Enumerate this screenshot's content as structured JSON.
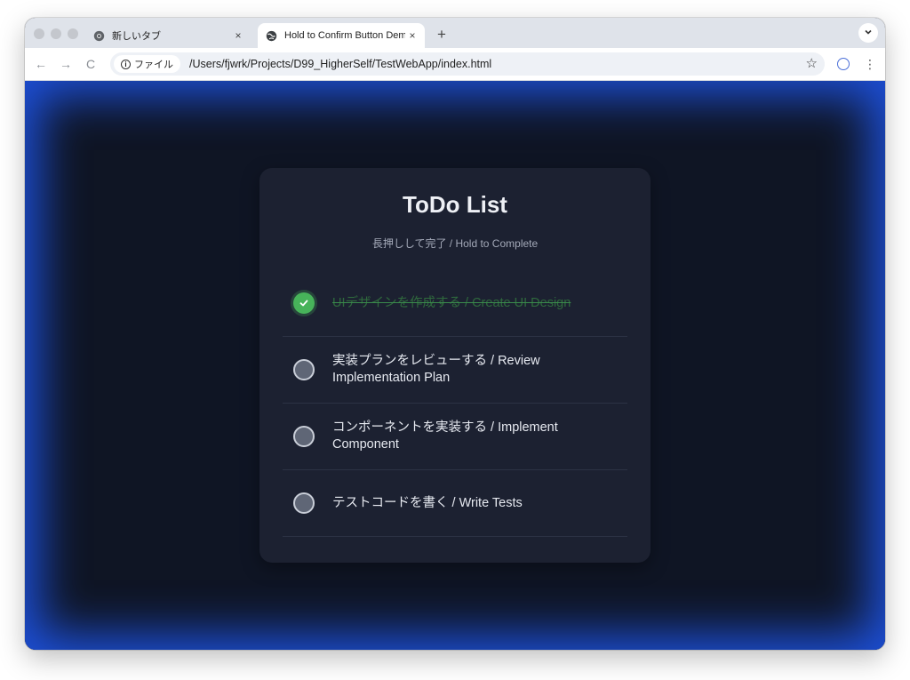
{
  "browser": {
    "tabs": [
      {
        "label": "新しいタブ",
        "close": "×",
        "active": false,
        "icon": "chrome-icon"
      },
      {
        "label": "Hold to Confirm Button Demo",
        "close": "×",
        "active": true,
        "icon": "globe-icon"
      }
    ],
    "new_tab": "+",
    "tab_search_icon": "chevron-down-icon",
    "nav": {
      "back": "←",
      "forward": "→",
      "reload": "C"
    },
    "address": {
      "scheme_chip": "ファイル",
      "url": "/Users/fjwrk/Projects/D99_HigherSelf/TestWebApp/index.html",
      "bookmark": "☆"
    },
    "menu": "⋮"
  },
  "page": {
    "title": "ToDo List",
    "subtitle": "長押しして完了 / Hold to Complete",
    "accent_color": "#47b35a",
    "items": [
      {
        "label": "UIデザインを作成する / Create UI Design",
        "done": true
      },
      {
        "label": "実装プランをレビューする / Review Implementation Plan",
        "done": false
      },
      {
        "label": "コンポーネントを実装する / Implement Component",
        "done": false
      },
      {
        "label": "テストコードを書く / Write Tests",
        "done": false
      }
    ]
  }
}
